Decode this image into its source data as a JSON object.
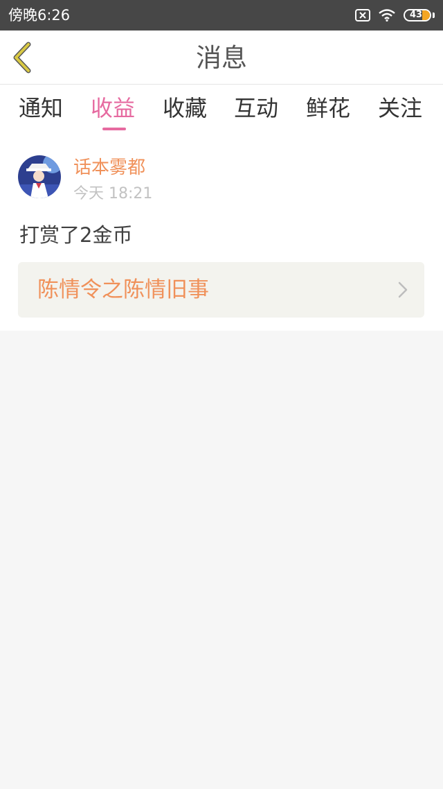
{
  "status_bar": {
    "time": "傍晚6:26",
    "battery": "43",
    "icons": [
      "sim-card-disabled-icon",
      "wifi-icon",
      "battery-icon"
    ]
  },
  "header": {
    "title": "消息",
    "back_icon": "back-chevron-icon"
  },
  "tabs": [
    {
      "label": "通知",
      "active": false
    },
    {
      "label": "收益",
      "active": true
    },
    {
      "label": "收藏",
      "active": false
    },
    {
      "label": "互动",
      "active": false
    },
    {
      "label": "鲜花",
      "active": false
    },
    {
      "label": "关注",
      "active": false
    }
  ],
  "message": {
    "username": "话本雾都",
    "time": "今天 18:21",
    "text": "打赏了2金币",
    "book_title": "陈情令之陈情旧事"
  },
  "colors": {
    "status_bar_bg": "#474747",
    "accent_pink": "#e66aa0",
    "accent_orange": "#f0915a",
    "back_icon": "#c8b93a",
    "page_bg": "#f6f6f6",
    "book_link_bg": "#f3f3ee"
  }
}
